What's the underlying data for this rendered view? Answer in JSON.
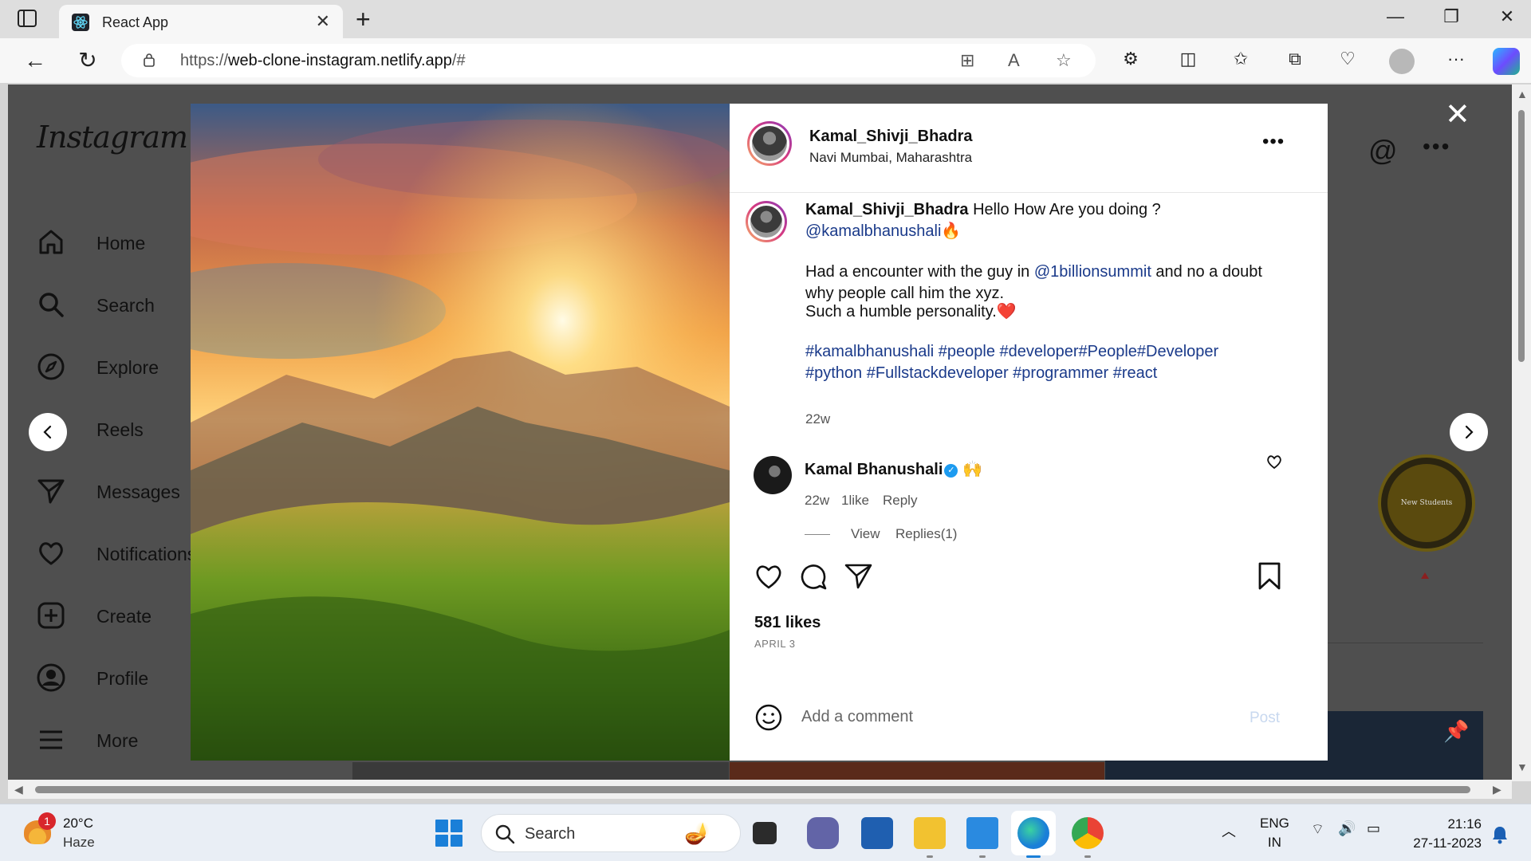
{
  "browser": {
    "tab_title": "React App",
    "url_host": "https://",
    "url_domain": "web-clone-instagram.netlify.app",
    "url_path": "/#"
  },
  "sidebar": {
    "logo": "Instagram",
    "items": [
      {
        "label": "Home",
        "icon": "home-icon"
      },
      {
        "label": "Search",
        "icon": "search-icon"
      },
      {
        "label": "Explore",
        "icon": "compass-icon"
      },
      {
        "label": "Reels",
        "icon": "reels-icon"
      },
      {
        "label": "Messages",
        "icon": "send-icon"
      },
      {
        "label": "Notifications",
        "icon": "heart-icon"
      },
      {
        "label": "Create",
        "icon": "plus-square-icon"
      },
      {
        "label": "Profile",
        "icon": "profile-icon"
      },
      {
        "label": "More",
        "icon": "menu-icon"
      }
    ]
  },
  "story": {
    "text": "New Students"
  },
  "post": {
    "username": "Kamal_Shivji_Bhadra",
    "location": "Navi Mumbai, Maharashtra",
    "caption": {
      "author": "Kamal_Shivji_Bhadra",
      "line1": "Hello How Are you doing ?",
      "mention": "@kamalbhanushali",
      "emoji1": "🔥",
      "line2_pre": "Had a encounter with the guy in ",
      "line2_mention": "@1billionsummit",
      "line2_post": " and no a doubt why people call him the xyz.",
      "line3": "Such a humble personality.",
      "emoji2": "❤️",
      "hashtags_1": "#kamalbhanushali #people #developer#People#Developer",
      "hashtags_2": "#python #Fullstackdeveloper #programmer #react",
      "time": "22w"
    },
    "comment": {
      "author": "Kamal Bhanushali",
      "verified_mark": "✓",
      "emoji": "🙌",
      "time": "22w",
      "likes": "1like",
      "reply": "Reply",
      "view": "View",
      "replies": "Replies(1)"
    },
    "likes": "581 likes",
    "date": "APRIL 3",
    "add_comment_placeholder": "Add a comment",
    "post_button": "Post"
  },
  "taskbar": {
    "weather_badge": "1",
    "temperature": "20°C",
    "weather": "Haze",
    "search_label": "Search",
    "lang_1": "ENG",
    "lang_2": "IN",
    "time": "21:16",
    "date": "27-11-2023"
  },
  "colors": {
    "overlay": "#4f4f4f",
    "link": "#1a3a8a",
    "post_button_disabled": "#c8d8ef"
  }
}
